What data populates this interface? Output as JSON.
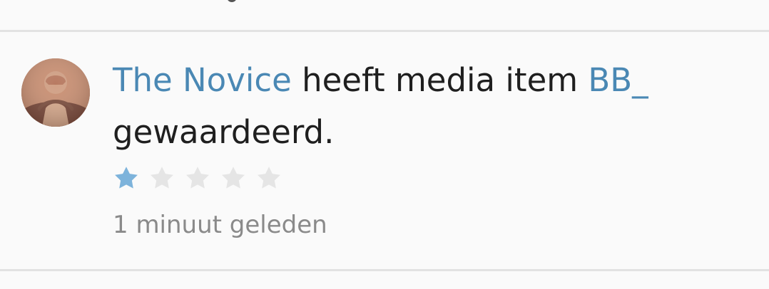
{
  "activity": {
    "user": "The Novice",
    "action_text": " heeft media item ",
    "item": "BB_",
    "line2": "gewaardeerd."
  },
  "rating": {
    "value": 1,
    "max": 5,
    "active_color": "#7db3db",
    "inactive_color": "#e5e5e5"
  },
  "timestamp": "1 minuut geleden",
  "icons": {
    "avatar": "user-avatar-icon",
    "star": "star-icon"
  }
}
